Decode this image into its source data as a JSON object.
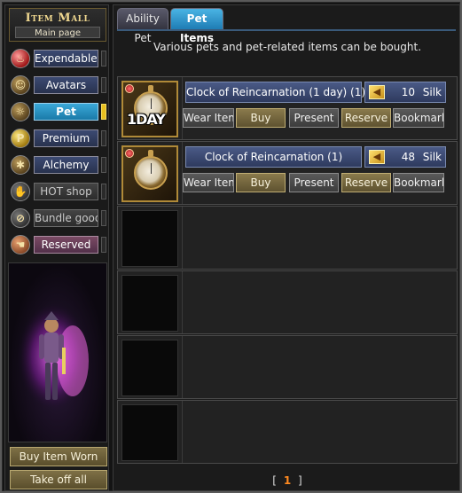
{
  "header": {
    "title": "Item Mall",
    "subtitle": "Main page"
  },
  "sidebar": {
    "categories": [
      {
        "label": "Expendables",
        "icon": "potion-icon",
        "state": "normal"
      },
      {
        "label": "Avatars",
        "icon": "avatar-icon",
        "state": "normal"
      },
      {
        "label": "Pet",
        "icon": "pet-icon",
        "state": "active"
      },
      {
        "label": "Premium",
        "icon": "premium-icon",
        "state": "normal"
      },
      {
        "label": "Alchemy",
        "icon": "alchemy-icon",
        "state": "normal"
      },
      {
        "label": "HOT shop",
        "icon": "hot-shop-icon",
        "state": "disabled"
      },
      {
        "label": "Bundle goods",
        "icon": "bundle-icon",
        "state": "disabled"
      },
      {
        "label": "Reserved",
        "icon": "reserved-icon",
        "state": "reserved"
      }
    ],
    "buttons": {
      "buy_worn": "Buy Item Worn",
      "take_off": "Take off all"
    }
  },
  "tabs": [
    {
      "label": "Ability Pet",
      "active": false
    },
    {
      "label": "Pet Items",
      "active": true
    }
  ],
  "description": "Various pets and pet-related items can be bought.",
  "items": [
    {
      "name": "Clock of Reincarnation (1 day) (1)",
      "price": "10",
      "currency": "Silk",
      "badge": "1DAY",
      "actions": [
        "Wear Item",
        "Buy",
        "Present",
        "Reserve",
        "Bookmark"
      ]
    },
    {
      "name": "Clock of Reincarnation (1)",
      "price": "48",
      "currency": "Silk",
      "badge": "",
      "actions": [
        "Wear Item",
        "Buy",
        "Present",
        "Reserve",
        "Bookmark"
      ]
    }
  ],
  "pager": {
    "left": "[",
    "current": "1",
    "right": "]"
  },
  "colors": {
    "accent": "#1e7cb4",
    "gold": "#c0ae74",
    "price_panel": "#2e3a5e",
    "page_current": "#ff8a20"
  }
}
